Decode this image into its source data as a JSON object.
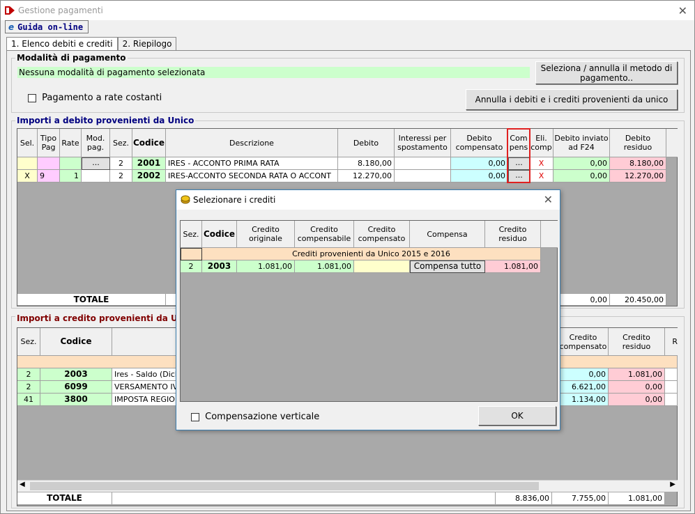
{
  "window": {
    "title": "Gestione pagamenti"
  },
  "toolbar": {
    "guida_label": "Guida on-line"
  },
  "tabs": [
    {
      "label": "1. Elenco debiti e crediti"
    },
    {
      "label": "2. Riepilogo"
    }
  ],
  "modalita": {
    "title": "Modalità di pagamento",
    "status": "Nessuna modalità di pagamento selezionata",
    "select_button": "Seleziona / annulla il metodo di pagamento..",
    "rate_checkbox": "Pagamento a rate costanti",
    "annulla_button": "Annulla i debiti e i crediti provenienti da unico"
  },
  "debiti": {
    "title": "Importi a debito provenienti da Unico",
    "headers": [
      "Sel.",
      "Tipo Pag",
      "Rate",
      "Mod. pag.",
      "Sez.",
      "Codice",
      "Descrizione",
      "Debito",
      "Interessi per spostamento",
      "Debito compensato",
      "Com pens",
      "Eli. comp",
      "Debito inviato ad F24",
      "Debito residuo"
    ],
    "rows": [
      {
        "sel": "",
        "tipo": "",
        "rate": "",
        "mod": "...",
        "sez": "2",
        "codice": "2001",
        "descr": "IRES - ACCONTO PRIMA RATA",
        "debito": "8.180,00",
        "interessi": "",
        "compensato": "0,00",
        "compens": "...",
        "eli": "X",
        "inviato": "0,00",
        "residuo": "8.180,00"
      },
      {
        "sel": "X",
        "tipo": "9",
        "rate": "1",
        "mod": "",
        "sez": "2",
        "codice": "2002",
        "descr": "IRES-ACCONTO SECONDA RATA O ACCONT",
        "debito": "12.270,00",
        "interessi": "",
        "compensato": "0,00",
        "compens": "...",
        "eli": "X",
        "inviato": "0,00",
        "residuo": "12.270,00"
      }
    ],
    "totale_label": "TOTALE",
    "totale_inviato": "0,00",
    "totale_residuo": "20.450,00"
  },
  "crediti": {
    "title": "Importi a credito provenienti da Un",
    "headers": {
      "sez": "Sez.",
      "codice": "Codice",
      "compensato": "Credito compensato",
      "residuo": "Credito residuo",
      "extra": "R"
    },
    "rows": [
      {
        "sez": "2",
        "codice": "2003",
        "descr": "Ires - Saldo (Dich",
        "compensato": "0,00",
        "residuo": "1.081,00"
      },
      {
        "sez": "2",
        "codice": "6099",
        "descr": "VERSAMENTO IV",
        "compensato": "6.621,00",
        "residuo": "0,00"
      },
      {
        "sez": "41",
        "codice": "3800",
        "descr": "IMPOSTA REGIO",
        "compensato": "1.134,00",
        "residuo": "0,00"
      }
    ],
    "totale_label": "TOTALE",
    "totale_a": "8.836,00",
    "totale_b": "7.755,00",
    "totale_c": "1.081,00"
  },
  "dialog": {
    "title": "Selezionare i crediti",
    "headers": [
      "Sez.",
      "Codice",
      "Credito originale",
      "Credito compensabile",
      "Credito compensato",
      "Compensa",
      "Credito residuo"
    ],
    "group_label": "Crediti provenienti da Unico 2015 e 2016",
    "row": {
      "sez": "2",
      "codice": "2003",
      "originale": "1.081,00",
      "compensabile": "1.081,00",
      "compensato": "",
      "compensa_button": "Compensa tutto",
      "residuo": "1.081,00"
    },
    "vertical_checkbox": "Compensazione verticale",
    "ok_button": "OK"
  },
  "colors": {
    "green": "#ccffcc",
    "pink": "#ffccd5",
    "yellow": "#ffffcc",
    "cyan": "#ccffff",
    "peach": "#fde0c0",
    "title_blue": "#000080",
    "title_red": "#800000"
  }
}
